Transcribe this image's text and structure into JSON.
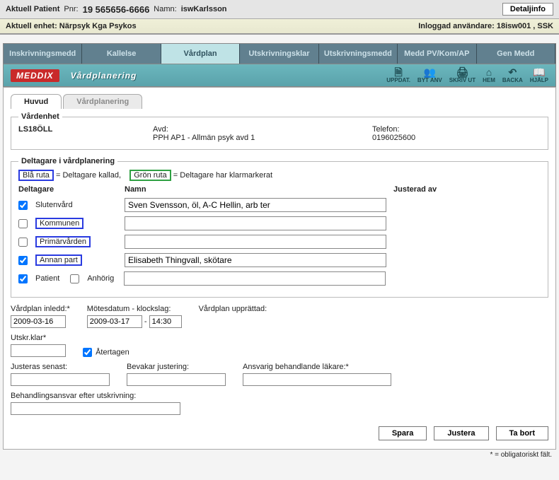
{
  "header": {
    "aktuell_patient_label": "Aktuell Patient",
    "pnr_label": "Pnr:",
    "pnr": "19 565656-6666",
    "namn_label": "Namn:",
    "namn": "iswKarlsson",
    "detaljinfo": "Detaljinfo",
    "enhet_label": "Aktuell enhet:",
    "enhet": "Närpsyk Kga Psykos",
    "inloggad_label": "Inloggad användare:",
    "inloggad": "18isw001 , SSK"
  },
  "nav": {
    "tabs": [
      "Inskrivningsmedd",
      "Kallelse",
      "Vårdplan",
      "Utskrivningsklar",
      "Utskrivningsmedd",
      "Medd PV/Kom/AP",
      "Gen Medd"
    ],
    "active": "Vårdplan"
  },
  "toolbar": {
    "logo": "MEDDIX",
    "title": "Vårdplanering",
    "icons": [
      {
        "name": "uppdat",
        "label": "UPPDAT.",
        "glyph": "🗎"
      },
      {
        "name": "bytanv",
        "label": "BYT ANV",
        "glyph": "👥"
      },
      {
        "name": "skrivut",
        "label": "SKRIV UT",
        "glyph": "🖨"
      },
      {
        "name": "hem",
        "label": "HEM",
        "glyph": "⌂"
      },
      {
        "name": "backa",
        "label": "BACKA",
        "glyph": "↶"
      },
      {
        "name": "hjalp",
        "label": "HJÄLP",
        "glyph": "📖"
      }
    ]
  },
  "subtabs": {
    "items": [
      "Huvud",
      "Vårdplanering"
    ],
    "active": "Huvud"
  },
  "vardenhet": {
    "legend": "Vårdenhet",
    "unit": "LS18ÖLL",
    "avd_label": "Avd:",
    "avd": "PPH AP1 - Allmän psyk avd 1",
    "telefon_label": "Telefon:",
    "telefon": "0196025600"
  },
  "deltagare": {
    "legend": "Deltagare i vårdplanering",
    "blue_label": "Blå ruta",
    "blue_desc": " = Deltagare kallad,",
    "green_label": "Grön ruta",
    "green_desc": " = Deltagare har klarmarkerat",
    "col_del": "Deltagare",
    "col_namn": "Namn",
    "col_just": "Justerad av",
    "rows": [
      {
        "label": "Slutenvård",
        "checked": true,
        "boxed": false,
        "namn": "Sven Svensson, öl, A-C Hellin, arb ter"
      },
      {
        "label": "Kommunen",
        "checked": false,
        "boxed": true,
        "namn": ""
      },
      {
        "label": "Primärvården",
        "checked": false,
        "boxed": true,
        "namn": ""
      },
      {
        "label": "Annan part",
        "checked": true,
        "boxed": true,
        "namn": "Elisabeth Thingvall, skötare"
      }
    ],
    "patient_label": "Patient",
    "patient_checked": true,
    "anhorig_label": "Anhörig",
    "anhorig_checked": false,
    "patient_namn": ""
  },
  "form": {
    "inledd_label": "Vårdplan inledd:*",
    "inledd": "2009-03-16",
    "mote_label": "Mötesdatum - klockslag:",
    "mote_date": "2009-03-17",
    "mote_time": "14:30",
    "upprattad_label": "Vårdplan upprättad:",
    "upprattad": "",
    "utskrklar_label": "Utskr.klar*",
    "utskrklar": "",
    "atertagen_label": "Återtagen",
    "atertagen_checked": true,
    "justeras_label": "Justeras senast:",
    "justeras": "",
    "bevakar_label": "Bevakar justering:",
    "bevakar": "",
    "ansvarig_label": "Ansvarig behandlande läkare:*",
    "ansvarig": "",
    "behandling_label": "Behandlingsansvar efter utskrivning:",
    "behandling": ""
  },
  "buttons": {
    "spara": "Spara",
    "justera": "Justera",
    "tabort": "Ta bort"
  },
  "footnote": "* = obligatoriskt fält."
}
